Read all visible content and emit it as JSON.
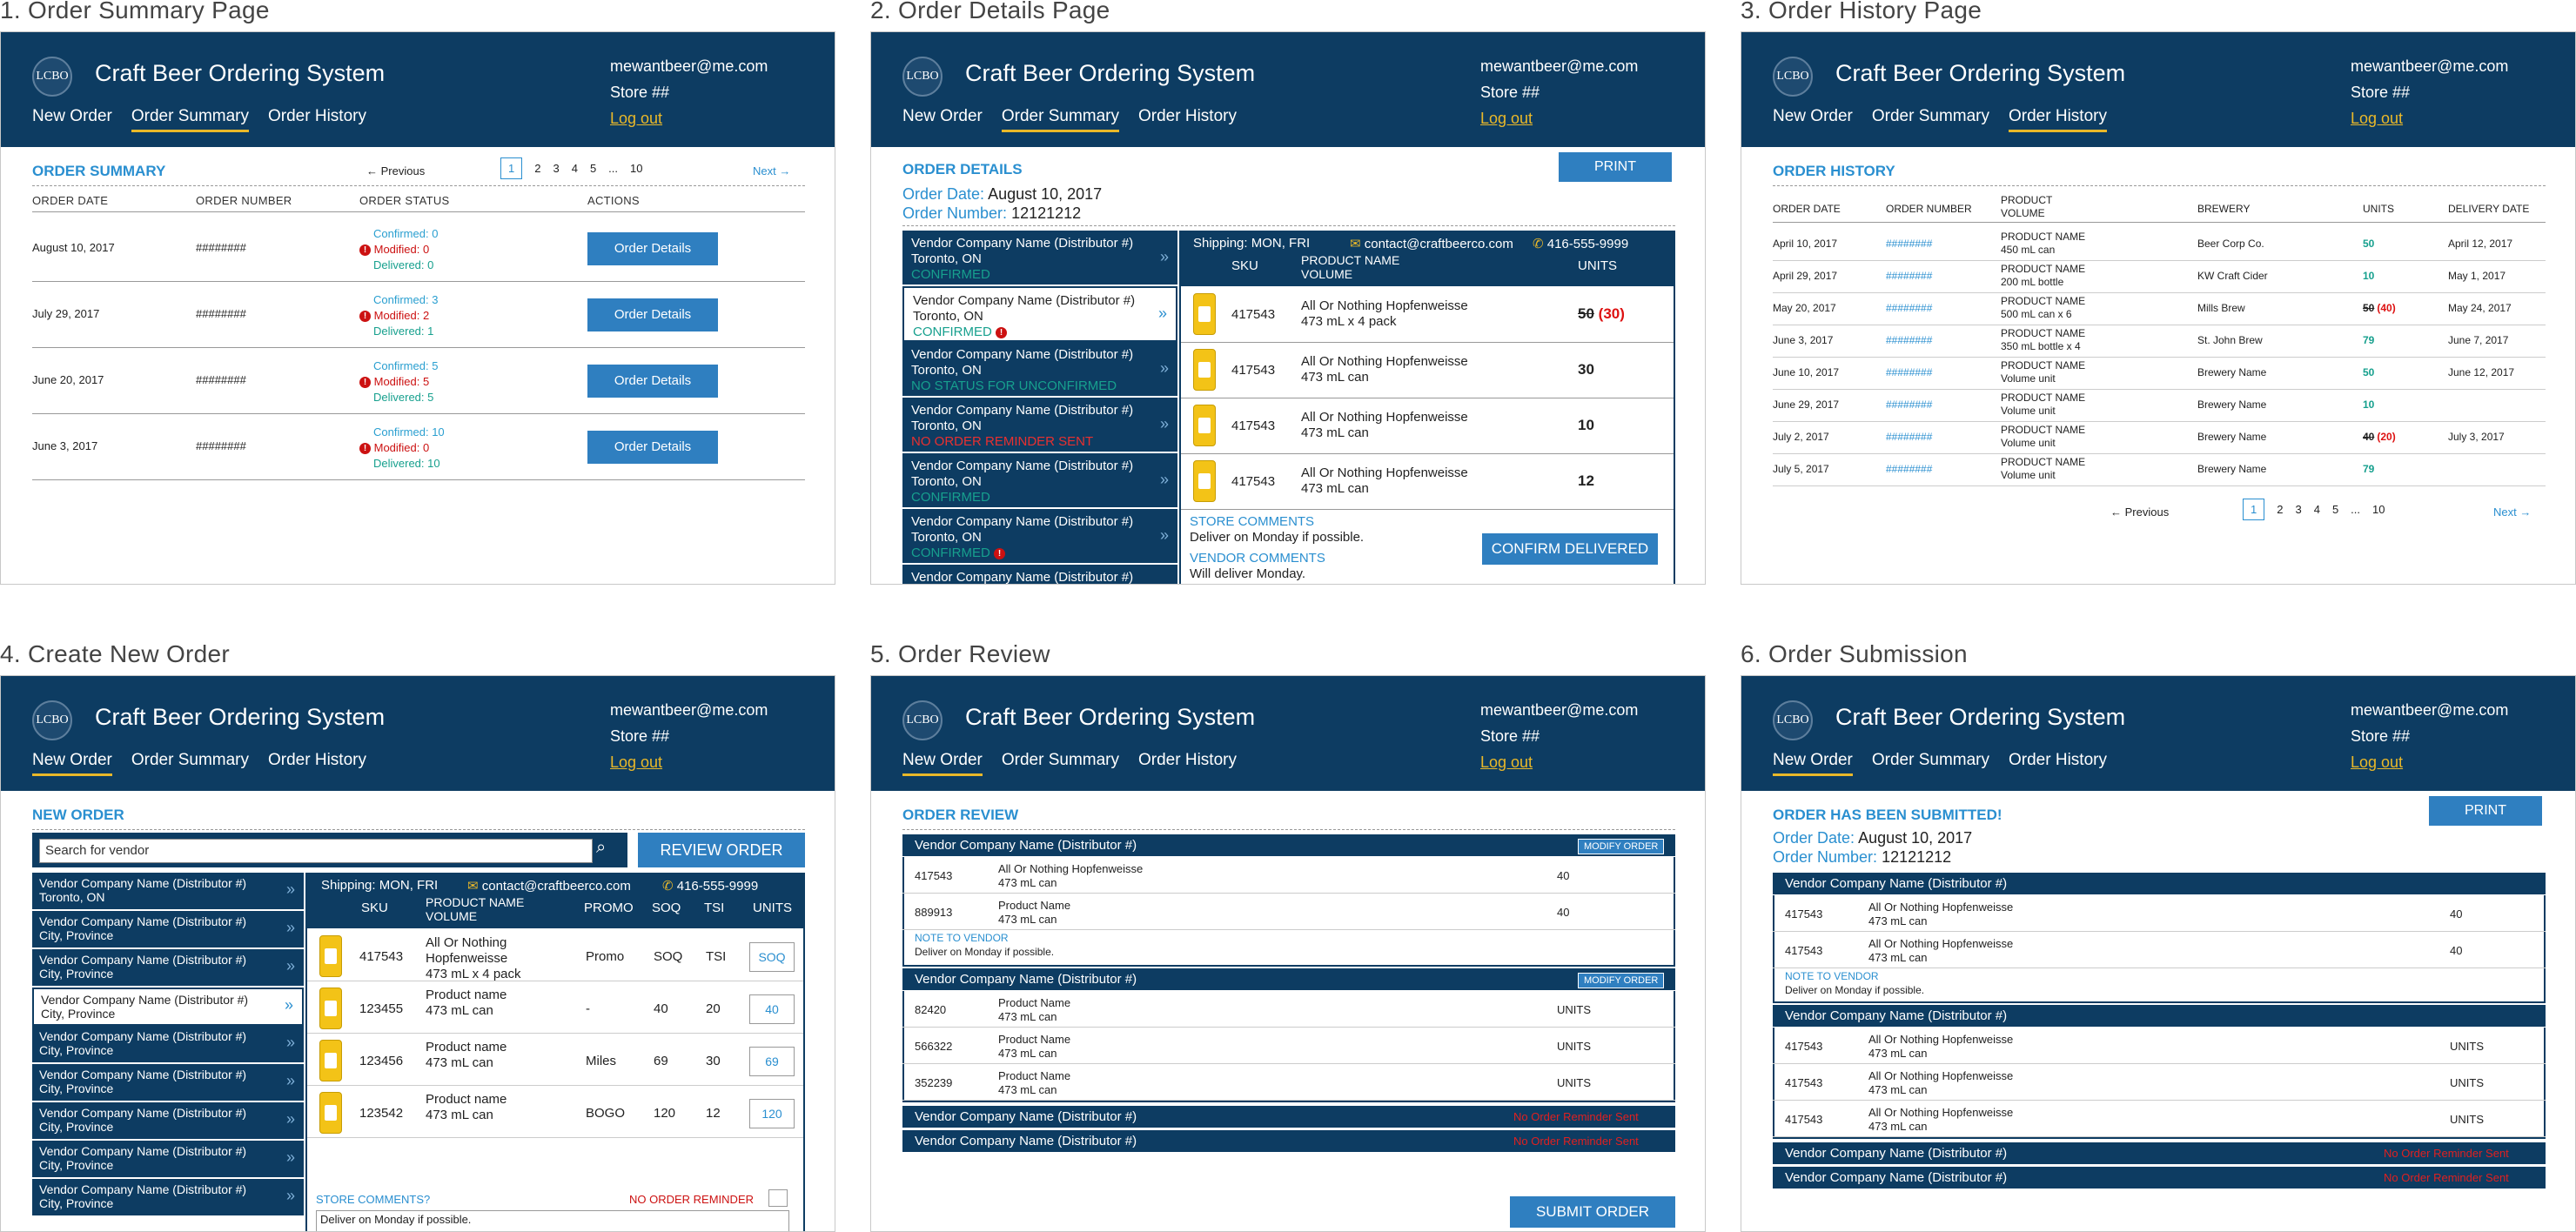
{
  "header": {
    "logo": "LCBO",
    "app_title": "Craft Beer Ordering System",
    "email": "mewantbeer@me.com",
    "store": "Store ##",
    "logout": "Log out",
    "nav": [
      "New Order",
      "Order Summary",
      "Order History"
    ]
  },
  "panels": {
    "p1": "1. Order Summary Page",
    "p2": "2. Order Details Page",
    "p3": "3. Order History Page",
    "p4": "4. Create New Order",
    "p5": "5. Order Review",
    "p6": "6. Order Submission"
  },
  "summary": {
    "title": "ORDER SUMMARY",
    "previous": "Previous",
    "next": "Next",
    "pages": [
      "1",
      "2",
      "3",
      "4",
      "5",
      "...",
      "10"
    ],
    "cols": [
      "ORDER DATE",
      "ORDER NUMBER",
      "ORDER STATUS",
      "ACTIONS"
    ],
    "rows": [
      {
        "date": "August 10, 2017",
        "num": "########",
        "confirmed": "Confirmed: 0",
        "modified": "Modified: 0",
        "delivered": "Delivered: 0",
        "action": "Order Details"
      },
      {
        "date": "July 29, 2017",
        "num": "########",
        "confirmed": "Confirmed: 3",
        "modified": "Modified: 2",
        "delivered": "Delivered: 1",
        "action": "Order Details"
      },
      {
        "date": "June 20, 2017",
        "num": "########",
        "confirmed": "Confirmed: 5",
        "modified": "Modified: 5",
        "delivered": "Delivered: 5",
        "action": "Order Details"
      },
      {
        "date": "June 3, 2017",
        "num": "########",
        "confirmed": "Confirmed: 10",
        "modified": "Modified: 0",
        "delivered": "Delivered: 10",
        "action": "Order Details"
      }
    ]
  },
  "details": {
    "title": "ORDER DETAILS",
    "print": "PRINT",
    "date_label": "Order Date:",
    "date": "August 10, 2017",
    "num_label": "Order Number:",
    "num": "12121212",
    "shipping": "Shipping: MON, FRI",
    "contact": "contact@craftbeerco.com",
    "phone": "416-555-9999",
    "cols": [
      "SKU",
      "PRODUCT NAME",
      "VOLUME",
      "UNITS"
    ],
    "vendors": [
      {
        "name": "Vendor Company Name (Distributor #)",
        "city": "Toronto, ON",
        "status": "CONFIRMED"
      },
      {
        "name": "Vendor Company Name (Distributor #)",
        "city": "Toronto, ON",
        "status": "CONFIRMED"
      },
      {
        "name": "Vendor Company Name (Distributor #)",
        "city": "Toronto, ON",
        "status": "NO STATUS FOR UNCONFIRMED"
      },
      {
        "name": "Vendor Company Name (Distributor #)",
        "city": "Toronto, ON",
        "status": "NO ORDER REMINDER SENT"
      },
      {
        "name": "Vendor Company Name (Distributor #)",
        "city": "Toronto, ON",
        "status": "CONFIRMED"
      },
      {
        "name": "Vendor Company Name (Distributor #)",
        "city": "Toronto, ON",
        "status": "CONFIRMED"
      },
      {
        "name": "Vendor Company Name (Distributor #)",
        "city": "",
        "status": ""
      }
    ],
    "items": [
      {
        "sku": "417543",
        "name": "All Or Nothing Hopfenweisse",
        "vol": "473 mL x 4 pack",
        "old": "50",
        "units": "(30)"
      },
      {
        "sku": "417543",
        "name": "All Or Nothing Hopfenweisse",
        "vol": "473 mL can",
        "old": "",
        "units": "30"
      },
      {
        "sku": "417543",
        "name": "All Or Nothing Hopfenweisse",
        "vol": "473 mL can",
        "old": "",
        "units": "10"
      },
      {
        "sku": "417543",
        "name": "All Or Nothing Hopfenweisse",
        "vol": "473 mL can",
        "old": "",
        "units": "12"
      }
    ],
    "store_comments_label": "STORE COMMENTS",
    "store_comments": "Deliver on Monday if possible.",
    "vendor_comments_label": "VENDOR COMMENTS",
    "vendor_comments": "Will deliver Monday.",
    "confirm": "CONFIRM DELIVERED"
  },
  "history": {
    "title": "ORDER HISTORY",
    "cols": [
      "ORDER DATE",
      "ORDER NUMBER",
      "PRODUCT",
      "VOLUME",
      "BREWERY",
      "UNITS",
      "DELIVERY DATE"
    ],
    "rows": [
      {
        "date": "April 10, 2017",
        "num": "########",
        "pname": "PRODUCT NAME",
        "pvol": "450 mL can",
        "brewery": "Beer Corp Co.",
        "units": "50",
        "old": "",
        "delivery": "April 12, 2017"
      },
      {
        "date": "April 29, 2017",
        "num": "########",
        "pname": "PRODUCT NAME",
        "pvol": "200 mL bottle",
        "brewery": "KW Craft Cider",
        "units": "10",
        "old": "",
        "delivery": "May 1, 2017"
      },
      {
        "date": "May 20, 2017",
        "num": "########",
        "pname": "PRODUCT NAME",
        "pvol": "500 mL can x 6",
        "brewery": "Mills Brew",
        "units": "(40)",
        "old": "50",
        "delivery": "May 24, 2017"
      },
      {
        "date": "June 3, 2017",
        "num": "########",
        "pname": "PRODUCT NAME",
        "pvol": "350 mL bottle x 4",
        "brewery": "St. John Brew",
        "units": "79",
        "old": "",
        "delivery": "June 7, 2017"
      },
      {
        "date": "June 10, 2017",
        "num": "########",
        "pname": "PRODUCT NAME",
        "pvol": "Volume unit",
        "brewery": "Brewery Name",
        "units": "50",
        "old": "",
        "delivery": "June 12, 2017"
      },
      {
        "date": "June 29, 2017",
        "num": "########",
        "pname": "PRODUCT NAME",
        "pvol": "Volume unit",
        "brewery": "Brewery Name",
        "units": "10",
        "old": "",
        "delivery": ""
      },
      {
        "date": "July 2, 2017",
        "num": "########",
        "pname": "PRODUCT NAME",
        "pvol": "Volume unit",
        "brewery": "Brewery Name",
        "units": "(20)",
        "old": "40",
        "delivery": "July 3, 2017"
      },
      {
        "date": "July 5, 2017",
        "num": "########",
        "pname": "PRODUCT NAME",
        "pvol": "Volume unit",
        "brewery": "Brewery Name",
        "units": "79",
        "old": "",
        "delivery": ""
      }
    ],
    "previous": "Previous",
    "next": "Next",
    "pages": [
      "1",
      "2",
      "3",
      "4",
      "5",
      "...",
      "10"
    ]
  },
  "neworder": {
    "title": "NEW ORDER",
    "search_placeholder": "Search for vendor",
    "review": "REVIEW ORDER",
    "vendors": [
      {
        "name": "Vendor Company Name (Distributor #)",
        "city": "Toronto, ON"
      },
      {
        "name": "Vendor Company Name (Distributor #)",
        "city": "City, Province"
      },
      {
        "name": "Vendor Company Name (Distributor #)",
        "city": "City, Province"
      },
      {
        "name": "Vendor Company Name (Distributor #)",
        "city": "City, Province"
      },
      {
        "name": "Vendor Company Name (Distributor #)",
        "city": "City, Province"
      },
      {
        "name": "Vendor Company Name (Distributor #)",
        "city": "City, Province"
      },
      {
        "name": "Vendor Company Name (Distributor #)",
        "city": "City, Province"
      },
      {
        "name": "Vendor Company Name (Distributor #)",
        "city": "City, Province"
      },
      {
        "name": "Vendor Company Name (Distributor #)",
        "city": "City, Province"
      }
    ],
    "shipping": "Shipping: MON, FRI",
    "contact": "contact@craftbeerco.com",
    "phone": "416-555-9999",
    "cols": [
      "SKU",
      "PRODUCT NAME",
      "VOLUME",
      "PROMO",
      "SOQ",
      "TSI",
      "UNITS"
    ],
    "items": [
      {
        "sku": "417543",
        "name": "All Or Nothing Hopfenweisse",
        "vol": "473 mL x 4 pack",
        "promo": "Promo",
        "soq": "SOQ",
        "tsi": "TSI",
        "units": "SOQ"
      },
      {
        "sku": "123455",
        "name": "Product name",
        "vol": "473 mL can",
        "promo": "-",
        "soq": "40",
        "tsi": "20",
        "units": "40"
      },
      {
        "sku": "123456",
        "name": "Product name",
        "vol": "473 mL can",
        "promo": "Miles",
        "soq": "69",
        "tsi": "30",
        "units": "69"
      },
      {
        "sku": "123542",
        "name": "Product name",
        "vol": "473 mL can",
        "promo": "BOGO",
        "soq": "120",
        "tsi": "12",
        "units": "120"
      }
    ],
    "store_comments_label": "STORE COMMENTS?",
    "no_reminder": "NO ORDER REMINDER",
    "store_comments": "Deliver on Monday if possible."
  },
  "review": {
    "title": "ORDER REVIEW",
    "vendor": "Vendor Company Name (Distributor #)",
    "modify": "MODIFY ORDER",
    "group1": [
      {
        "sku": "417543",
        "name": "All Or Nothing Hopfenweisse",
        "vol": "473 mL can",
        "units": "40"
      },
      {
        "sku": "889913",
        "name": "Product Name",
        "vol": "473 mL can",
        "units": "40"
      }
    ],
    "note_label": "NOTE TO VENDOR",
    "note": "Deliver on Monday if possible.",
    "group2": [
      {
        "sku": "82420",
        "name": "Product Name",
        "vol": "473 mL can",
        "units": "UNITS"
      },
      {
        "sku": "566322",
        "name": "Product Name",
        "vol": "473 mL can",
        "units": "UNITS"
      },
      {
        "sku": "352239",
        "name": "Product Name",
        "vol": "473 mL can",
        "units": "UNITS"
      }
    ],
    "no_reminder": "No Order Reminder Sent",
    "submit": "SUBMIT ORDER"
  },
  "submission": {
    "title": "ORDER HAS BEEN SUBMITTED!",
    "print": "PRINT",
    "date_label": "Order Date:",
    "date": "August 10, 2017",
    "num_label": "Order Number:",
    "num": "12121212",
    "vendor": "Vendor Company Name (Distributor #)",
    "group1": [
      {
        "sku": "417543",
        "name": "All Or Nothing Hopfenweisse",
        "vol": "473 mL can",
        "units": "40"
      },
      {
        "sku": "417543",
        "name": "All Or Nothing Hopfenweisse",
        "vol": "473 mL can",
        "units": "40"
      }
    ],
    "note_label": "NOTE TO VENDOR",
    "note": "Deliver on Monday if possible.",
    "group2": [
      {
        "sku": "417543",
        "name": "All Or Nothing Hopfenweisse",
        "vol": "473 mL can",
        "units": "UNITS"
      },
      {
        "sku": "417543",
        "name": "All Or Nothing Hopfenweisse",
        "vol": "473 mL can",
        "units": "UNITS"
      },
      {
        "sku": "417543",
        "name": "All Or Nothing Hopfenweisse",
        "vol": "473 mL can",
        "units": "UNITS"
      }
    ],
    "no_reminder": "No Order Reminder Sent"
  },
  "colors": {
    "navy": "#0d3c62",
    "accent": "#e9b829",
    "button": "#2f7fc0",
    "link": "#2a8fd0",
    "error": "#cc1111",
    "success": "#17a08e"
  }
}
